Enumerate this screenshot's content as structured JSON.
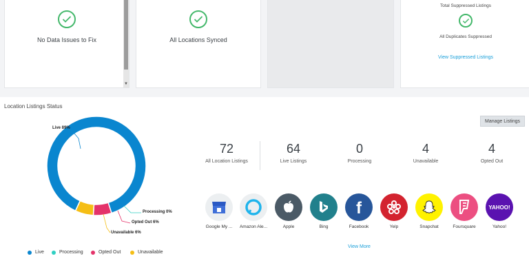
{
  "top_cards": {
    "data_issues_text": "No Data Issues to Fix",
    "synced_text": "All Locations Synced",
    "suppressed_title": "Total Suppressed Listings",
    "duplicates_text": "All Duplicates Suppressed",
    "view_suppressed_link": "View Suppressed Listings"
  },
  "section": {
    "title": "Location Listings Status",
    "manage_button": "Manage Listings",
    "view_more": "View More"
  },
  "stats": [
    {
      "value": "72",
      "label": "All Location Listings"
    },
    {
      "value": "64",
      "label": "Live Listings"
    },
    {
      "value": "0",
      "label": "Processing"
    },
    {
      "value": "4",
      "label": "Unavailable"
    },
    {
      "value": "4",
      "label": "Opted Out"
    }
  ],
  "publishers": [
    {
      "name": "Google My ...",
      "icon": "google-my-business-icon",
      "bg": "#eceff1"
    },
    {
      "name": "Amazon Ale...",
      "icon": "amazon-alexa-icon",
      "bg": "#eceff1"
    },
    {
      "name": "Apple",
      "icon": "apple-icon",
      "bg": "#4b5a66"
    },
    {
      "name": "Bing",
      "icon": "bing-icon",
      "bg": "#21808c"
    },
    {
      "name": "Facebook",
      "icon": "facebook-icon",
      "bg": "#27569a"
    },
    {
      "name": "Yelp",
      "icon": "yelp-icon",
      "bg": "#d3232f"
    },
    {
      "name": "Snapchat",
      "icon": "snapchat-icon",
      "bg": "#fff200"
    },
    {
      "name": "Foursquare",
      "icon": "foursquare-icon",
      "bg": "#ec4f81"
    },
    {
      "name": "Yahoo!",
      "icon": "yahoo-icon",
      "bg": "#5a12b0"
    }
  ],
  "chart_data": {
    "type": "pie",
    "categories": [
      "Live",
      "Processing",
      "Opted Out",
      "Unavailable"
    ],
    "values": [
      89,
      0,
      6,
      6
    ],
    "labels": [
      "Live 89%",
      "Processing 0%",
      "Opted Out 6%",
      "Unavailable 6%"
    ],
    "colors": [
      "#0a86cf",
      "#2ecfc2",
      "#e4336a",
      "#f5be15"
    ],
    "legend": "bottom"
  }
}
